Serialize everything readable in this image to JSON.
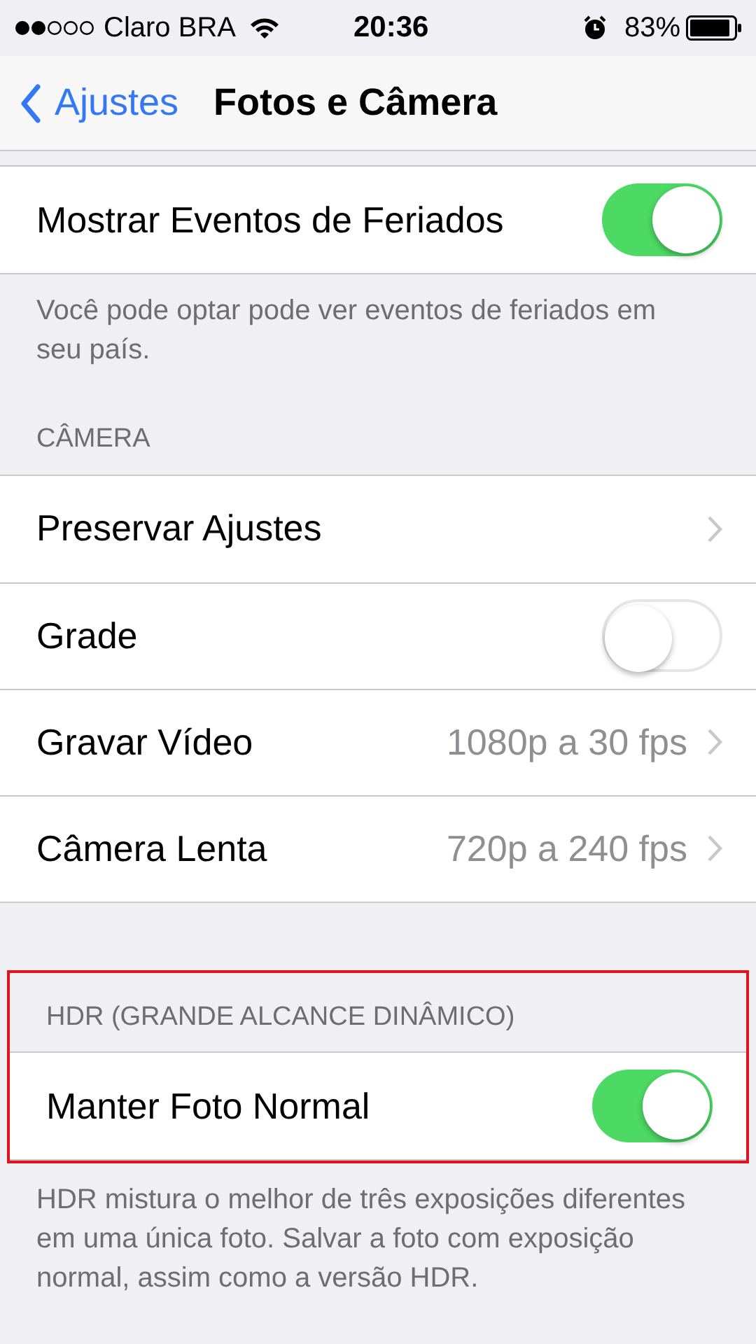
{
  "status_bar": {
    "carrier": "Claro BRA",
    "time": "20:36",
    "battery": "83%"
  },
  "nav": {
    "back": "Ajustes",
    "title": "Fotos e Câmera"
  },
  "sections": [
    {
      "highlighted": false,
      "rows": [
        {
          "kind": "toggle",
          "label": "Mostrar Eventos de Feriados",
          "on": true
        }
      ],
      "footer": "Você pode optar pode ver eventos de feriados em seu país."
    },
    {
      "highlighted": false,
      "header": "CÂMERA",
      "rows": [
        {
          "kind": "link",
          "label": "Preservar Ajustes"
        },
        {
          "kind": "toggle",
          "label": "Grade",
          "on": false
        },
        {
          "kind": "link",
          "label": "Gravar Vídeo",
          "value": "1080p a 30 fps"
        },
        {
          "kind": "link",
          "label": "Câmera Lenta",
          "value": "720p a 240 fps"
        }
      ]
    },
    {
      "highlighted": true,
      "header": "HDR (GRANDE ALCANCE DINÂMICO)",
      "rows": [
        {
          "kind": "toggle",
          "label": "Manter Foto Normal",
          "on": true
        }
      ],
      "footer": "HDR mistura o melhor de três exposições diferentes em uma única foto. Salvar a foto com exposição normal, assim como a versão HDR."
    }
  ]
}
